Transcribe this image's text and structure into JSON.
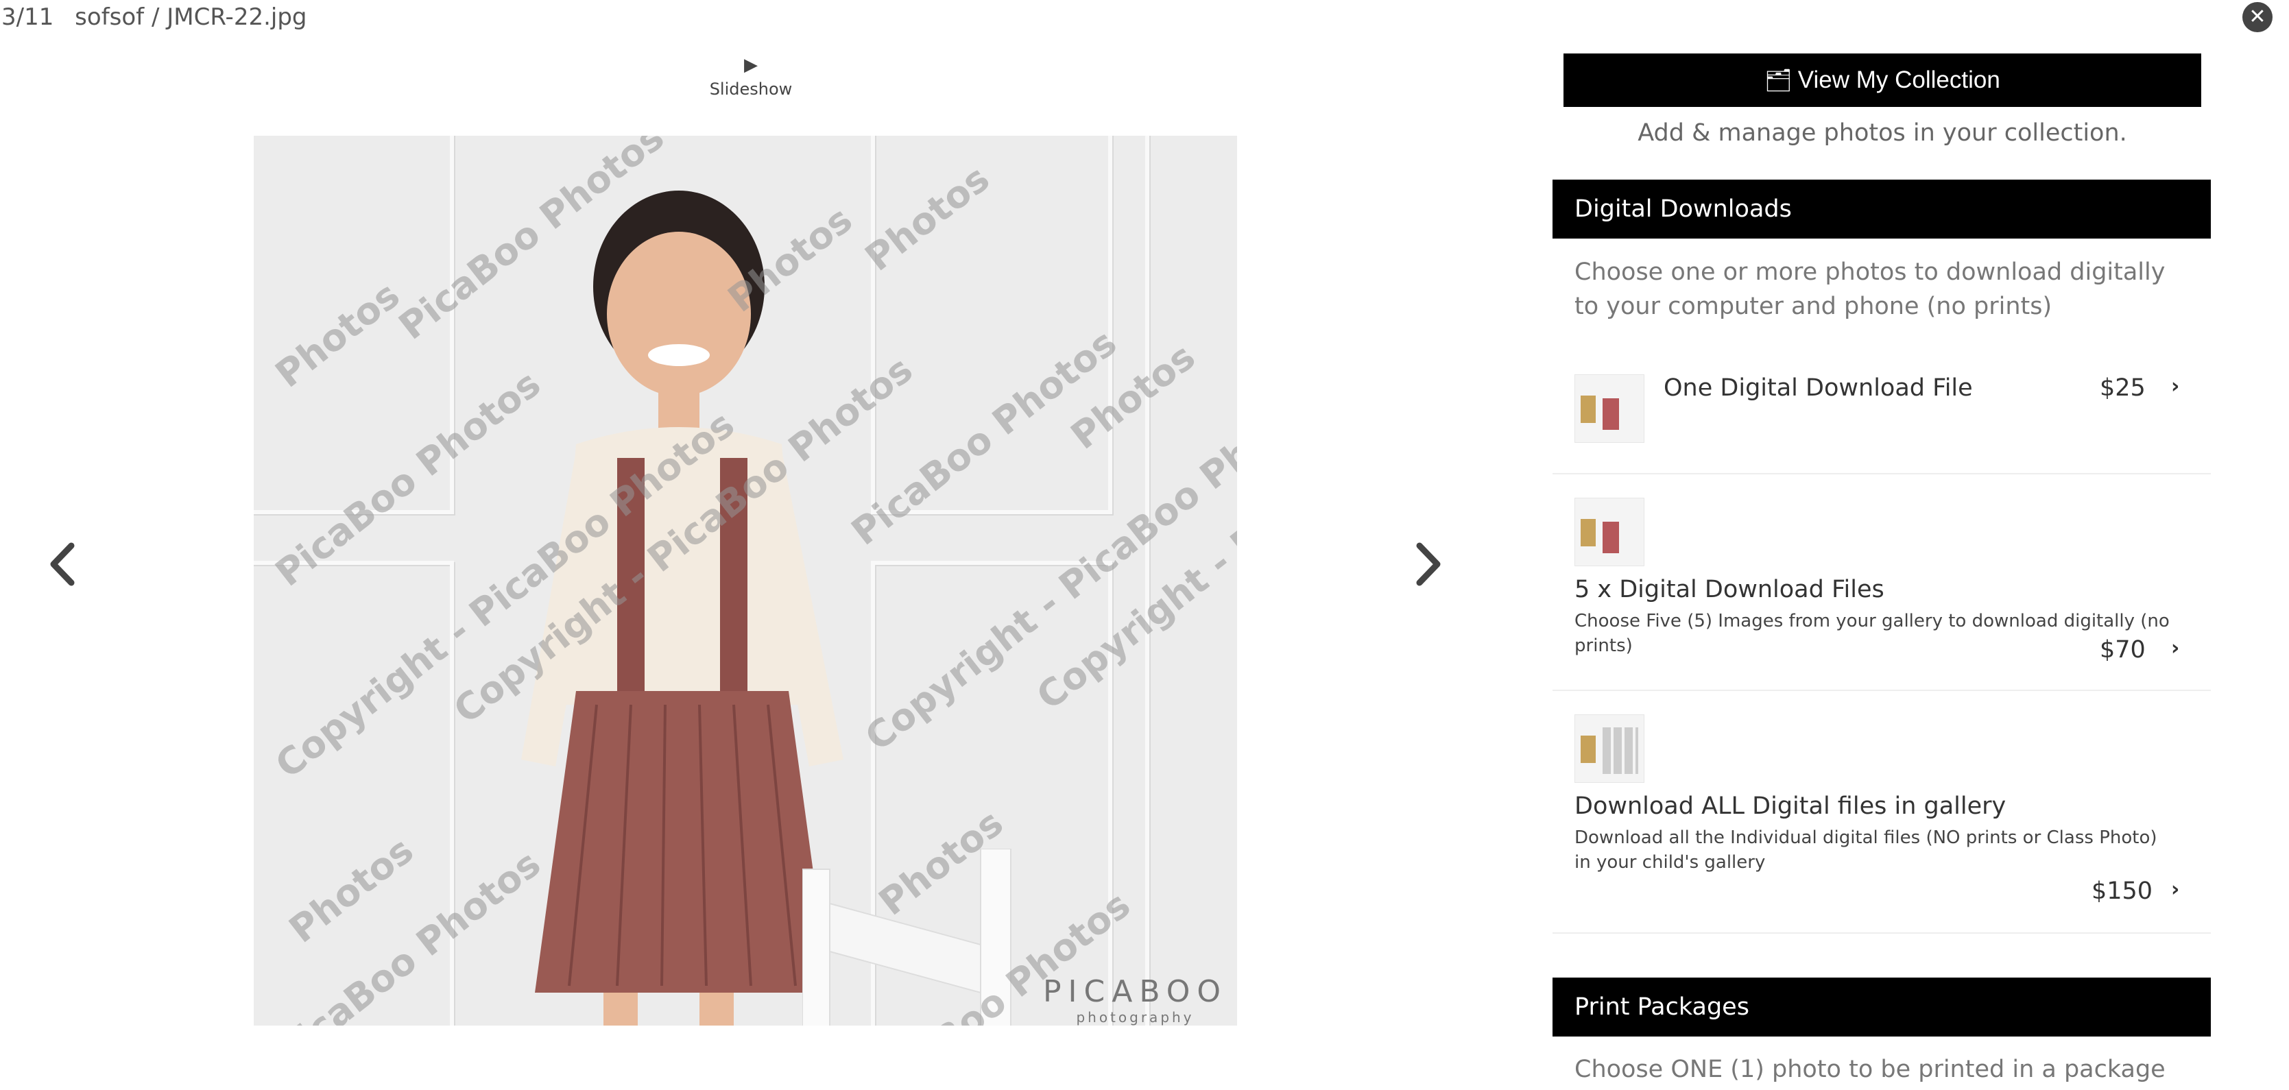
{
  "header": {
    "counter": "3/11",
    "breadcrumb": "sofsof / JMCR-22.jpg"
  },
  "slideshow": {
    "label": "Slideshow"
  },
  "photo": {
    "watermarks": [
      "Photos",
      "PicaBoo Photos",
      "Copyright - PicaBoo Photos"
    ],
    "brand_line1": "PICABOO",
    "brand_line2": "photography"
  },
  "collection": {
    "button_label": "View My Collection",
    "subtitle": "Add & manage photos in your collection."
  },
  "digital_downloads": {
    "title": "Digital Downloads",
    "description": "Choose one or more photos to download digitally to your computer and phone (no prints)",
    "items": [
      {
        "title": "One Digital Download File",
        "description": "",
        "price": "$25"
      },
      {
        "title": "5 x Digital Download Files",
        "description": "Choose Five (5) Images from your gallery to download digitally (no prints)",
        "price": "$70"
      },
      {
        "title": "Download ALL Digital files in gallery",
        "description": "Download all the Individual digital files (NO prints or Class Photo) in your child's gallery",
        "price": "$150"
      }
    ]
  },
  "print_packages": {
    "title": "Print Packages",
    "description": "Choose ONE (1) photo to be printed in a package"
  },
  "icons": {
    "close": "close-icon",
    "play": "play-icon",
    "prev": "chevron-left-icon",
    "next": "chevron-right-icon",
    "collection": "collection-icon",
    "item_chevron": "chevron-right-icon"
  },
  "colors": {
    "bar": "#000000",
    "text": "#444444",
    "muted": "#777777"
  }
}
